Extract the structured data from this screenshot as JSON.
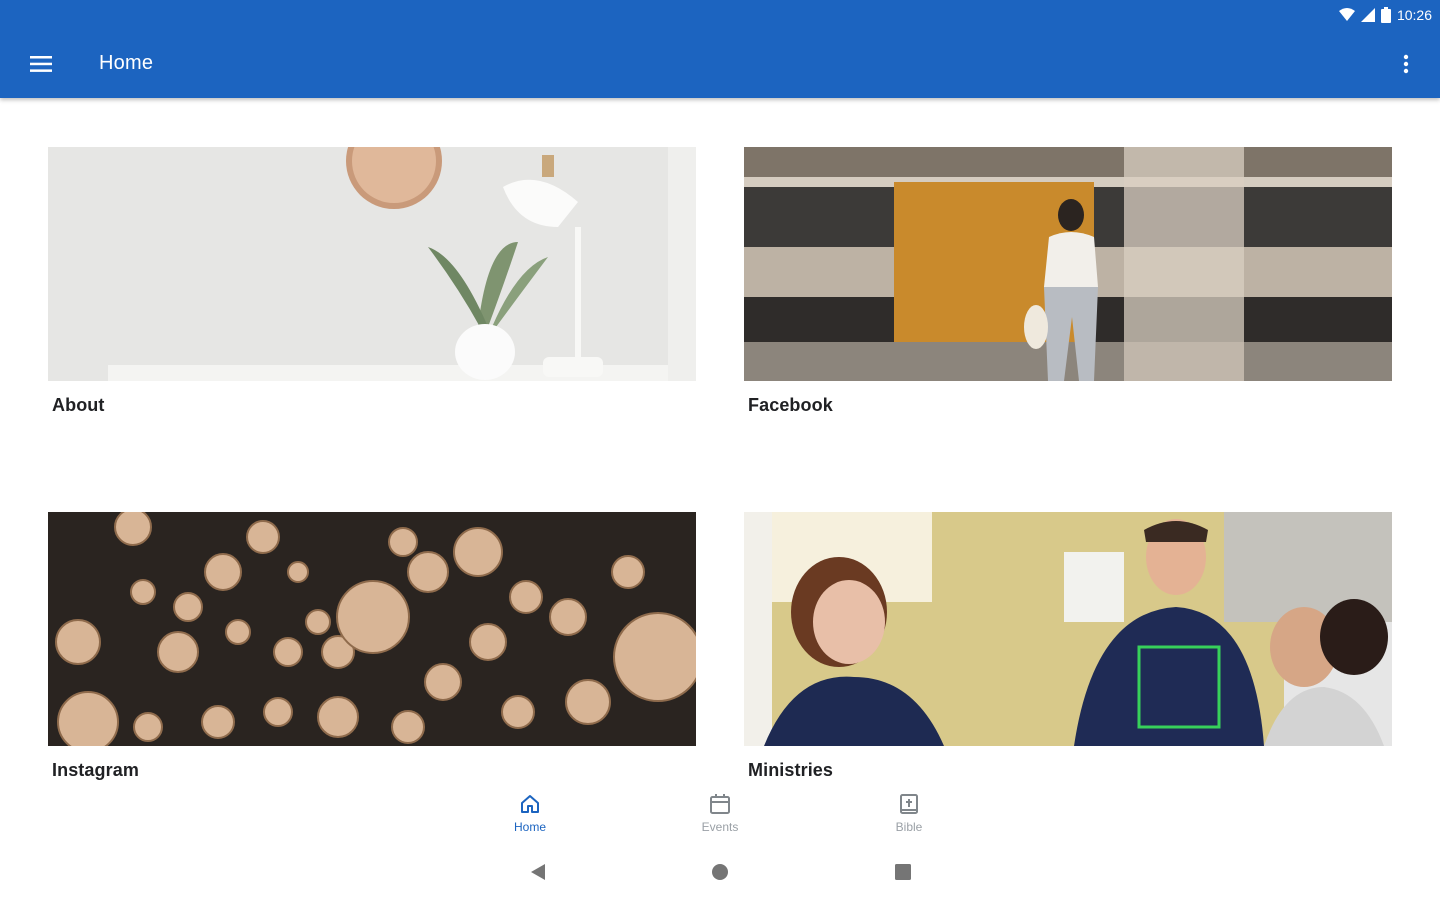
{
  "status_bar": {
    "time": "10:26",
    "icons": [
      "wifi-icon",
      "signal-icon",
      "battery-icon"
    ]
  },
  "app_bar": {
    "title": "Home",
    "menu_icon": "hamburger-menu-icon",
    "overflow_icon": "more-vert-icon",
    "color": "#1c64c0"
  },
  "cards": [
    {
      "label": "About",
      "image": "desk-lamp-plant-photo"
    },
    {
      "label": "Facebook",
      "image": "train-station-woman-photo"
    },
    {
      "label": "Instagram",
      "image": "cut-logs-photo"
    },
    {
      "label": "Ministries",
      "image": "volunteers-smiling-photo"
    }
  ],
  "bottom_nav": {
    "active": "Home",
    "active_color": "#1c64c0",
    "items": [
      {
        "label": "Home",
        "icon": "home-icon"
      },
      {
        "label": "Events",
        "icon": "calendar-icon"
      },
      {
        "label": "Bible",
        "icon": "bible-icon"
      }
    ]
  },
  "system_nav": {
    "icons": [
      "back-icon",
      "home-circle-icon",
      "recents-icon"
    ]
  }
}
